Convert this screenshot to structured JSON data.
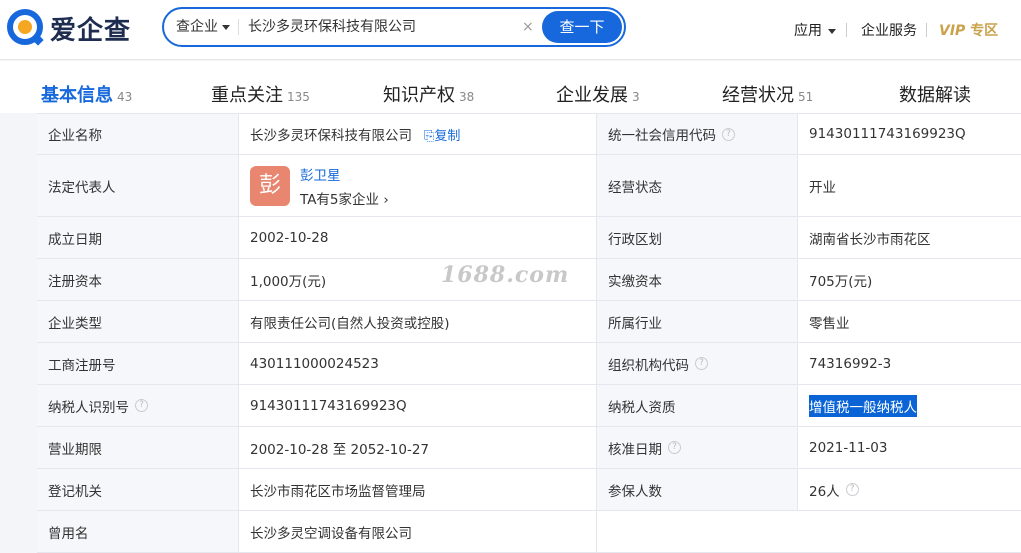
{
  "header": {
    "brand": "爱企查",
    "search_type": "查企业",
    "search_value": "长沙多灵环保科技有限公司",
    "clear": "×",
    "search_button": "查一下",
    "nav_app": "应用",
    "nav_service": "企业服务",
    "nav_vip_v": "VIP",
    "nav_vip_text": "专区"
  },
  "tabs": [
    {
      "label": "基本信息",
      "count": "43"
    },
    {
      "label": "重点关注",
      "count": "135"
    },
    {
      "label": "知识产权",
      "count": "38"
    },
    {
      "label": "企业发展",
      "count": "3"
    },
    {
      "label": "经营状况",
      "count": "51"
    },
    {
      "label": "数据解读",
      "count": ""
    }
  ],
  "info": {
    "company_name_label": "企业名称",
    "company_name": "长沙多灵环保科技有限公司",
    "copy": "复制",
    "credit_code_label": "统一社会信用代码",
    "credit_code": "91430111743169923Q",
    "legal_rep_label": "法定代表人",
    "legal_rep_avatar": "彭",
    "legal_rep_name": "彭卫星",
    "legal_rep_companies": "TA有5家企业",
    "status_label": "经营状态",
    "status": "开业",
    "founded_label": "成立日期",
    "founded": "2002-10-28",
    "region_label": "行政区划",
    "region": "湖南省长沙市雨花区",
    "reg_capital_label": "注册资本",
    "reg_capital": "1,000万(元)",
    "paid_capital_label": "实缴资本",
    "paid_capital": "705万(元)",
    "type_label": "企业类型",
    "type": "有限责任公司(自然人投资或控股)",
    "industry_label": "所属行业",
    "industry": "零售业",
    "reg_no_label": "工商注册号",
    "reg_no": "430111000024523",
    "org_code_label": "组织机构代码",
    "org_code": "74316992-3",
    "tax_id_label": "纳税人识别号",
    "tax_id": "91430111743169923Q",
    "taxpayer_label": "纳税人资质",
    "taxpayer": "增值税一般纳税人",
    "term_label": "营业期限",
    "term": "2002-10-28 至 2052-10-27",
    "approval_label": "核准日期",
    "approval": "2021-11-03",
    "authority_label": "登记机关",
    "authority": "长沙市雨花区市场监督管理局",
    "insured_label": "参保人数",
    "insured": "26人",
    "former_name_label": "曾用名",
    "former_name": "长沙多灵空调设备有限公司"
  },
  "watermark": "1688.com",
  "colors": {
    "accent": "#1668dc",
    "vip": "#c9a24a",
    "avatar": "#e8866f"
  }
}
